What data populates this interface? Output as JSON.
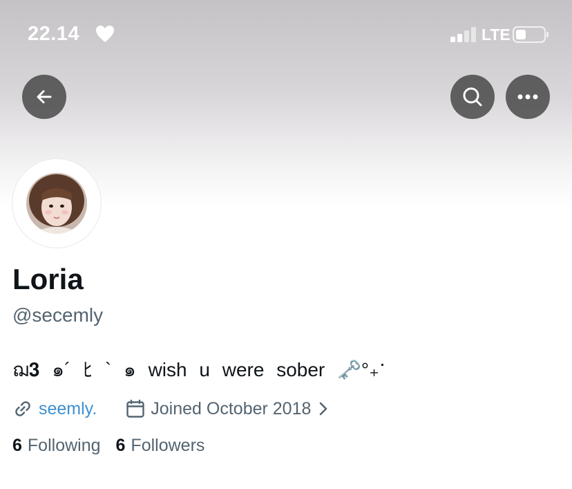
{
  "status_bar": {
    "time": "22.14",
    "network": "LTE",
    "icons": [
      "heart-icon",
      "signal-icon",
      "battery-icon"
    ]
  },
  "nav": {
    "icons": [
      "back-arrow-icon",
      "search-icon",
      "more-icon"
    ]
  },
  "profile": {
    "display_name": "Loria",
    "handle": "@secemly",
    "bio": "ฌ𝟑 ๑´ ﾋ ` ๑ wish u were sober 🗝️°₊ॱ",
    "website": "seemly.",
    "joined": "Joined October 2018",
    "following_count": "6",
    "following_label": "Following",
    "followers_count": "6",
    "followers_label": "Followers"
  },
  "colors": {
    "link": "#3d8fd1",
    "secondary_text": "#536471",
    "primary_text": "#0f1419",
    "nav_button": "#3c3c3c"
  }
}
